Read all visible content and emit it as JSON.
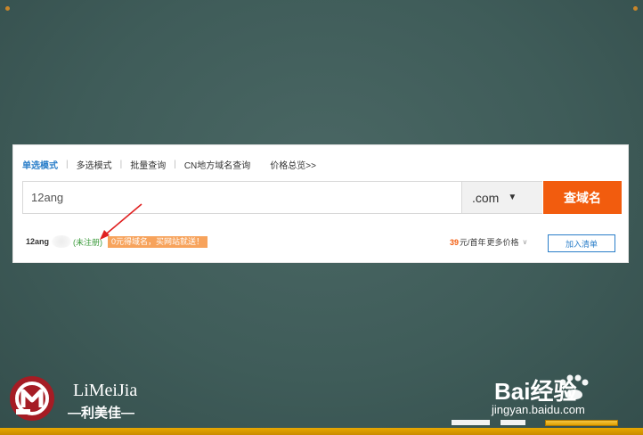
{
  "search_modes": [
    {
      "label": "单选模式",
      "active": true
    },
    {
      "label": "多选模式",
      "active": false
    },
    {
      "label": "批量查询",
      "active": false
    },
    {
      "label": "CN地方域名查询",
      "active": false
    }
  ],
  "price_overview": "价格总览>>",
  "search": {
    "value": "12ang",
    "tld": ".com",
    "button": "查域名"
  },
  "result": {
    "domain": "12ang",
    "status": "(未注册)",
    "promo": "0元得域名，买网站就送！",
    "price_number": "39",
    "price_unit": "元/首年",
    "more_prices": "更多价格",
    "add_button": "加入清单"
  },
  "brand": {
    "name": "LiMeiJia",
    "cn": "—利美佳—"
  },
  "watermark": {
    "logo": "Bai经验",
    "url": "jingyan.baidu.com"
  },
  "colors": {
    "accent": "#f25c0e",
    "link": "#2a7ec9",
    "status_green": "#3a9a3a",
    "arrow": "#e02020"
  }
}
